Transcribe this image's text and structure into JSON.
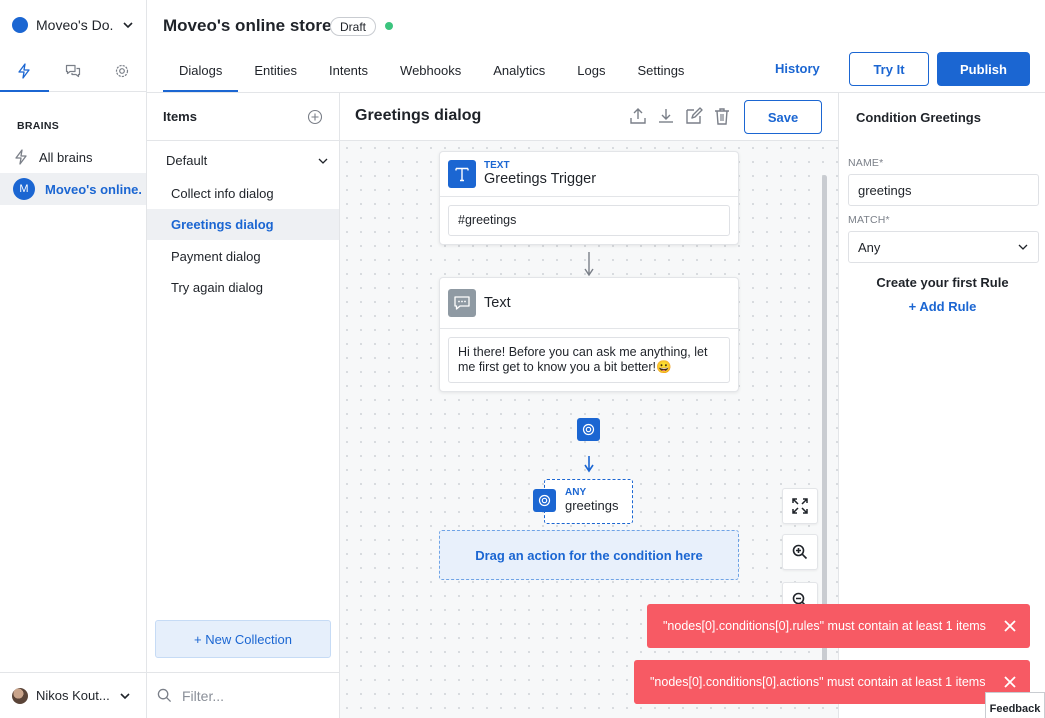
{
  "workspace": {
    "name": "Moveo's Do..."
  },
  "left_nav": {
    "section_title": "BRAINS",
    "items": [
      {
        "label": "All brains",
        "icon": "lightning-icon"
      },
      {
        "label": "Moveo's online...",
        "avatar": "M"
      }
    ]
  },
  "user": {
    "name": "Nikos Kout..."
  },
  "header": {
    "title": "Moveo's online store",
    "status_badge": "Draft",
    "status_color": "#3bc47e",
    "tabs": [
      "Dialogs",
      "Entities",
      "Intents",
      "Webhooks",
      "Analytics",
      "Logs",
      "Settings"
    ],
    "active_tab": "Dialogs",
    "history_label": "History",
    "try_label": "Try It",
    "publish_label": "Publish"
  },
  "items_panel": {
    "title": "Items",
    "collection": "Default",
    "dialogs": [
      "Collect info dialog",
      "Greetings dialog",
      "Payment dialog",
      "Try again dialog"
    ],
    "selected": "Greetings dialog",
    "new_collection_label": "+ New Collection",
    "filter_placeholder": "Filter..."
  },
  "canvas": {
    "title": "Greetings dialog",
    "save_label": "Save",
    "trigger_node": {
      "type_label": "TEXT",
      "name": "Greetings Trigger",
      "value": "#greetings"
    },
    "text_node": {
      "name": "Text",
      "message": "Hi there! Before you can ask me anything, let me first get to know you a bit better!😀"
    },
    "condition": {
      "type_label": "ANY",
      "name": "greetings"
    },
    "drop_zone_label": "Drag an action for the condition here"
  },
  "condition_panel": {
    "title": "Condition Greetings",
    "name_label": "NAME*",
    "name_value": "greetings",
    "match_label": "MATCH*",
    "match_value": "Any",
    "rule_title": "Create your first Rule",
    "add_rule_label": "+ Add Rule"
  },
  "toasts": [
    {
      "message": "\"nodes[0].conditions[0].rules\" must contain at least 1 items"
    },
    {
      "message": "\"nodes[0].conditions[0].actions\" must contain at least 1 items"
    }
  ],
  "toast_color": "#f75a64",
  "feedback_label": "Feedback",
  "accent_color": "#1b66d2"
}
